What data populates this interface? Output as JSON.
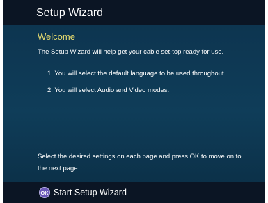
{
  "header": {
    "title": "Setup Wizard"
  },
  "page": {
    "heading": "Welcome",
    "intro": "The Setup Wizard will help get your cable set-top ready for use.",
    "steps": [
      "1.  You will select the default language to be used throughout.",
      "2.  You will select Audio and Video modes."
    ],
    "instruction": "Select the desired settings on each page and press OK to move on to the next page."
  },
  "footer": {
    "ok_icon": "ok-key-icon",
    "ok_icon_text": "OK",
    "action_label": "Start Setup Wizard"
  },
  "colors": {
    "heading": "#e8dc6e",
    "panel": "#0f3d59",
    "bar": "#0b1524",
    "ok_key": "#6a58b8"
  }
}
